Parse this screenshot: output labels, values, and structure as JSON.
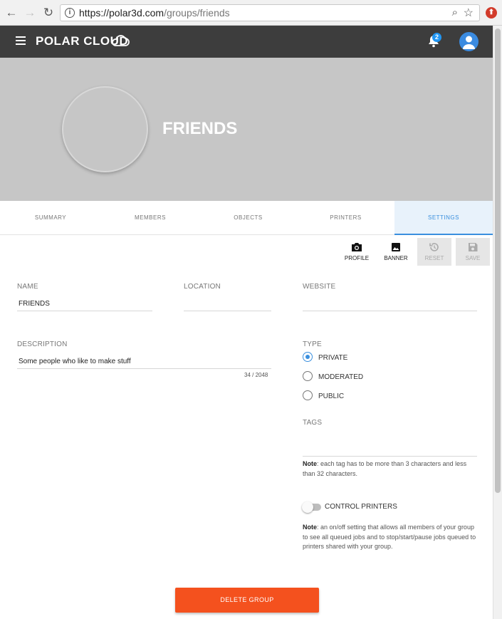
{
  "browser": {
    "url_host": "https://polar3d.com",
    "url_path": "/groups/friends",
    "info_glyph": "i",
    "back_glyph": "←",
    "forward_glyph": "→",
    "reload_glyph": "↻",
    "zoom_glyph": "⌕",
    "star_glyph": "☆"
  },
  "header": {
    "brand": "POLAR CLOUD",
    "notification_count": "2"
  },
  "group": {
    "title": "FRIENDS"
  },
  "tabs": [
    {
      "label": "SUMMARY"
    },
    {
      "label": "MEMBERS"
    },
    {
      "label": "OBJECTS"
    },
    {
      "label": "PRINTERS"
    },
    {
      "label": "SETTINGS",
      "active": true
    }
  ],
  "toolbar": {
    "profile_label": "PROFILE",
    "banner_label": "BANNER",
    "reset_label": "RESET",
    "save_label": "SAVE"
  },
  "form": {
    "name_label": "NAME",
    "name_value": "FRIENDS",
    "location_label": "LOCATION",
    "location_value": "",
    "website_label": "WEBSITE",
    "website_value": "",
    "description_label": "DESCRIPTION",
    "description_value": "Some people who like to make stuff",
    "description_counter": "34 / 2048",
    "type_label": "TYPE",
    "type_options": [
      {
        "label": "PRIVATE",
        "selected": true
      },
      {
        "label": "MODERATED",
        "selected": false
      },
      {
        "label": "PUBLIC",
        "selected": false
      }
    ],
    "tags_label": "TAGS",
    "tags_note_prefix": "Note",
    "tags_note": ": each tag has to be more than 3 characters and less than 32 characters.",
    "control_printers_label": "CONTROL PRINTERS",
    "control_printers_on": false,
    "control_note_prefix": "Note",
    "control_note": ": an on/off setting that allows all members of your group to see all queued jobs and to stop/start/pause jobs queued to printers shared with your group."
  },
  "actions": {
    "delete_label": "DELETE GROUP"
  },
  "colors": {
    "header_bg": "#3d3d3d",
    "banner_bg": "#c6c6c6",
    "accent": "#3a8fde",
    "danger": "#f4511e"
  }
}
